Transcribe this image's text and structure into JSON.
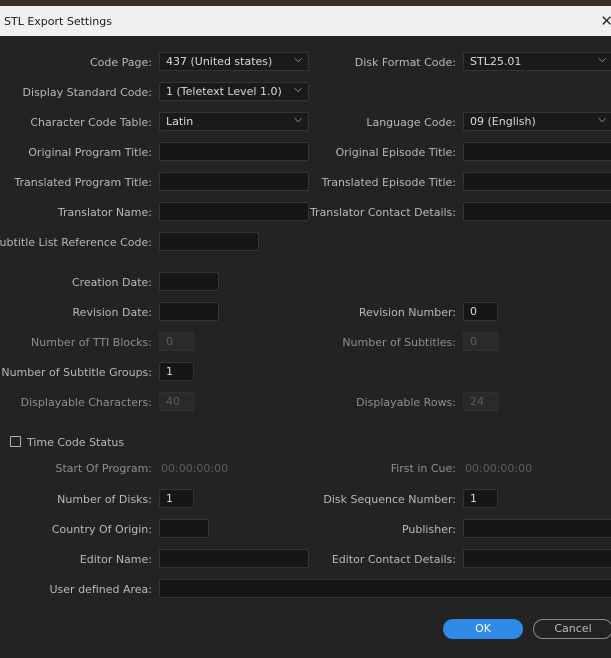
{
  "window": {
    "title": "STL Export Settings",
    "close_glyph": "✕"
  },
  "labels": {
    "code_page": "Code Page:",
    "disk_format_code": "Disk Format Code:",
    "display_standard_code": "Display Standard Code:",
    "character_code_table": "Character Code Table:",
    "language_code": "Language Code:",
    "original_program_title": "Original Program Title:",
    "original_episode_title": "Original Episode Title:",
    "translated_program_title": "Translated Program Title:",
    "translated_episode_title": "Translated Episode Title:",
    "translator_name": "Translator Name:",
    "translator_contact_details": "Translator Contact Details:",
    "subtitle_list_reference_code": "Subtitle List Reference Code:",
    "creation_date": "Creation Date:",
    "revision_date": "Revision Date:",
    "revision_number": "Revision Number:",
    "number_of_tti_blocks": "Number of TTI Blocks:",
    "number_of_subtitles": "Number of Subtitles:",
    "number_of_subtitle_groups": "Number of Subtitle Groups:",
    "displayable_characters": "Displayable Characters:",
    "displayable_rows": "Displayable Rows:",
    "time_code_status": "Time Code Status",
    "start_of_program": "Start Of Program:",
    "first_in_cue": "First in Cue:",
    "number_of_disks": "Number of Disks:",
    "disk_sequence_number": "Disk Sequence Number:",
    "country_of_origin": "Country Of Origin:",
    "publisher": "Publisher:",
    "editor_name": "Editor Name:",
    "editor_contact_details": "Editor Contact Details:",
    "user_defined_area": "User defined Area:"
  },
  "values": {
    "code_page": "437 (United states)",
    "disk_format_code": "STL25.01",
    "display_standard_code": "1 (Teletext Level 1.0)",
    "character_code_table": "Latin",
    "language_code": "09 (English)",
    "original_program_title": "",
    "original_episode_title": "",
    "translated_program_title": "",
    "translated_episode_title": "",
    "translator_name": "",
    "translator_contact_details": "",
    "subtitle_list_reference_code": "",
    "creation_date": "",
    "revision_date": "",
    "revision_number": "0",
    "number_of_tti_blocks": "0",
    "number_of_subtitles": "0",
    "number_of_subtitle_groups": "1",
    "displayable_characters": "40",
    "displayable_rows": "24",
    "time_code_status_checked": false,
    "start_of_program": "00:00:00:00",
    "first_in_cue": "00:00:00:00",
    "number_of_disks": "1",
    "disk_sequence_number": "1",
    "country_of_origin": "",
    "publisher": "",
    "editor_name": "",
    "editor_contact_details": "",
    "user_defined_area": ""
  },
  "icons": {
    "dropdown": "chevron-down-icon",
    "close": "close-icon"
  },
  "buttons": {
    "ok": "OK",
    "cancel": "Cancel"
  },
  "colors": {
    "accent": "#2f8be6",
    "background": "#232323",
    "field": "#161616"
  }
}
